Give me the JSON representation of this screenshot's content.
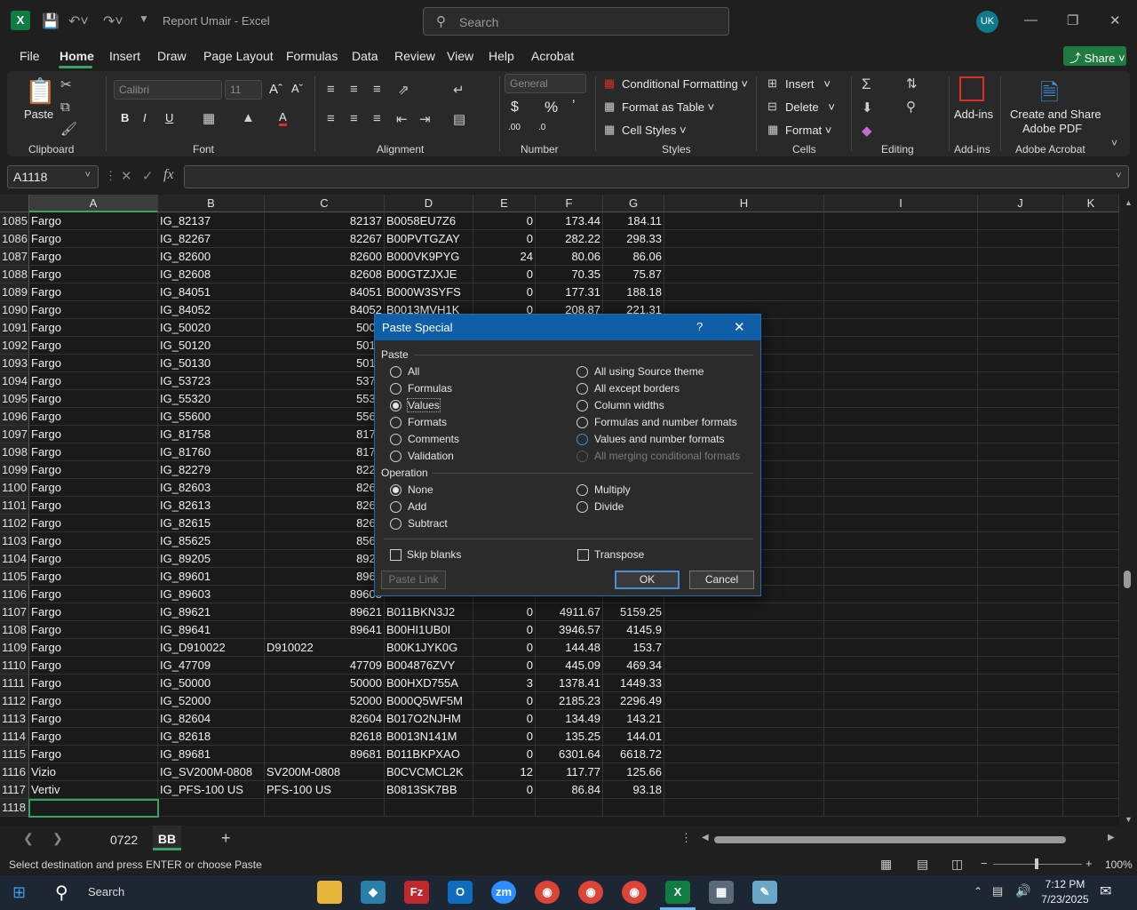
{
  "window": {
    "title": "Report Umair  -  Excel",
    "search_placeholder": "Search",
    "user_initials": "UK"
  },
  "menu": [
    "File",
    "Home",
    "Insert",
    "Draw",
    "Page Layout",
    "Formulas",
    "Data",
    "Review",
    "View",
    "Help",
    "Acrobat"
  ],
  "share_label": "Share",
  "ribbon": {
    "paste": "Paste",
    "font_name": "Calibri",
    "font_size": "11",
    "number_format": "General",
    "conditional_formatting": "Conditional Formatting",
    "format_as_table": "Format as Table",
    "cell_styles": "Cell Styles",
    "insert": "Insert",
    "delete": "Delete",
    "format": "Format",
    "addins": "Add-ins",
    "create_share_1": "Create and Share",
    "create_share_2": "Adobe PDF",
    "groups": [
      "Clipboard",
      "Font",
      "Alignment",
      "Number",
      "Styles",
      "Cells",
      "Editing",
      "Add-ins",
      "Adobe Acrobat"
    ]
  },
  "name_box": "A1118",
  "columns": [
    "A",
    "B",
    "C",
    "D",
    "E",
    "F",
    "G",
    "H",
    "I",
    "J",
    "K"
  ],
  "rows": [
    {
      "n": "1085",
      "a": "Fargo",
      "b": "IG_82137",
      "c": "82137",
      "d": "B0058EU7Z6",
      "e": "0",
      "f": "173.44",
      "g": "184.11"
    },
    {
      "n": "1086",
      "a": "Fargo",
      "b": "IG_82267",
      "c": "82267",
      "d": "B00PVTGZAY",
      "e": "0",
      "f": "282.22",
      "g": "298.33"
    },
    {
      "n": "1087",
      "a": "Fargo",
      "b": "IG_82600",
      "c": "82600",
      "d": "B000VK9PYG",
      "e": "24",
      "f": "80.06",
      "g": "86.06"
    },
    {
      "n": "1088",
      "a": "Fargo",
      "b": "IG_82608",
      "c": "82608",
      "d": "B00GTZJXJE",
      "e": "0",
      "f": "70.35",
      "g": "75.87"
    },
    {
      "n": "1089",
      "a": "Fargo",
      "b": "IG_84051",
      "c": "84051",
      "d": "B000W3SYFS",
      "e": "0",
      "f": "177.31",
      "g": "188.18"
    },
    {
      "n": "1090",
      "a": "Fargo",
      "b": "IG_84052",
      "c": "84052",
      "d": "B0013MVH1K",
      "e": "0",
      "f": "208.87",
      "g": "221.31"
    },
    {
      "n": "1091",
      "a": "Fargo",
      "b": "IG_50020",
      "c": "5002",
      "d": "",
      "e": "",
      "f": "",
      "g": ""
    },
    {
      "n": "1092",
      "a": "Fargo",
      "b": "IG_50120",
      "c": "5012",
      "d": "",
      "e": "",
      "f": "",
      "g": ""
    },
    {
      "n": "1093",
      "a": "Fargo",
      "b": "IG_50130",
      "c": "5013",
      "d": "",
      "e": "",
      "f": "",
      "g": ""
    },
    {
      "n": "1094",
      "a": "Fargo",
      "b": "IG_53723",
      "c": "5372",
      "d": "",
      "e": "",
      "f": "",
      "g": ""
    },
    {
      "n": "1095",
      "a": "Fargo",
      "b": "IG_55320",
      "c": "5532",
      "d": "",
      "e": "",
      "f": "",
      "g": ""
    },
    {
      "n": "1096",
      "a": "Fargo",
      "b": "IG_55600",
      "c": "5560",
      "d": "",
      "e": "",
      "f": "",
      "g": ""
    },
    {
      "n": "1097",
      "a": "Fargo",
      "b": "IG_81758",
      "c": "8175",
      "d": "",
      "e": "",
      "f": "",
      "g": ""
    },
    {
      "n": "1098",
      "a": "Fargo",
      "b": "IG_81760",
      "c": "8176",
      "d": "",
      "e": "",
      "f": "",
      "g": ""
    },
    {
      "n": "1099",
      "a": "Fargo",
      "b": "IG_82279",
      "c": "8227",
      "d": "",
      "e": "",
      "f": "",
      "g": ""
    },
    {
      "n": "1100",
      "a": "Fargo",
      "b": "IG_82603",
      "c": "8260",
      "d": "",
      "e": "",
      "f": "",
      "g": ""
    },
    {
      "n": "1101",
      "a": "Fargo",
      "b": "IG_82613",
      "c": "8261",
      "d": "",
      "e": "",
      "f": "",
      "g": ""
    },
    {
      "n": "1102",
      "a": "Fargo",
      "b": "IG_82615",
      "c": "8261",
      "d": "",
      "e": "",
      "f": "",
      "g": ""
    },
    {
      "n": "1103",
      "a": "Fargo",
      "b": "IG_85625",
      "c": "8562",
      "d": "",
      "e": "",
      "f": "",
      "g": ""
    },
    {
      "n": "1104",
      "a": "Fargo",
      "b": "IG_89205",
      "c": "8920",
      "d": "",
      "e": "",
      "f": "",
      "g": ""
    },
    {
      "n": "1105",
      "a": "Fargo",
      "b": "IG_89601",
      "c": "8960",
      "d": "",
      "e": "",
      "f": "",
      "g": ""
    },
    {
      "n": "1106",
      "a": "Fargo",
      "b": "IG_89603",
      "c": "89603",
      "d": "",
      "e": "",
      "f": "",
      "g": ""
    },
    {
      "n": "1107",
      "a": "Fargo",
      "b": "IG_89621",
      "c": "89621",
      "d": "B011BKN3J2",
      "e": "0",
      "f": "4911.67",
      "g": "5159.25"
    },
    {
      "n": "1108",
      "a": "Fargo",
      "b": "IG_89641",
      "c": "89641",
      "d": "B00HI1UB0I",
      "e": "0",
      "f": "3946.57",
      "g": "4145.9"
    },
    {
      "n": "1109",
      "a": "Fargo",
      "b": "IG_D910022",
      "c": "D910022",
      "d": "B00K1JYK0G",
      "e": "0",
      "f": "144.48",
      "g": "153.7"
    },
    {
      "n": "1110",
      "a": "Fargo",
      "b": "IG_47709",
      "c": "47709",
      "d": "B004876ZVY",
      "e": "0",
      "f": "445.09",
      "g": "469.34"
    },
    {
      "n": "1111",
      "a": "Fargo",
      "b": "IG_50000",
      "c": "50000",
      "d": "B00HXD755A",
      "e": "3",
      "f": "1378.41",
      "g": "1449.33"
    },
    {
      "n": "1112",
      "a": "Fargo",
      "b": "IG_52000",
      "c": "52000",
      "d": "B000Q5WF5M",
      "e": "0",
      "f": "2185.23",
      "g": "2296.49"
    },
    {
      "n": "1113",
      "a": "Fargo",
      "b": "IG_82604",
      "c": "82604",
      "d": "B017O2NJHM",
      "e": "0",
      "f": "134.49",
      "g": "143.21"
    },
    {
      "n": "1114",
      "a": "Fargo",
      "b": "IG_82618",
      "c": "82618",
      "d": "B0013N141M",
      "e": "0",
      "f": "135.25",
      "g": "144.01"
    },
    {
      "n": "1115",
      "a": "Fargo",
      "b": "IG_89681",
      "c": "89681",
      "d": "B011BKPXAO",
      "e": "0",
      "f": "6301.64",
      "g": "6618.72"
    },
    {
      "n": "1116",
      "a": "Vizio",
      "b": "IG_SV200M-0808",
      "c": "SV200M-0808",
      "d": "B0CVCMCL2K",
      "e": "12",
      "f": "117.77",
      "g": "125.66"
    },
    {
      "n": "1117",
      "a": "Vertiv",
      "b": "IG_PFS-100 US",
      "c": "PFS-100 US",
      "d": "B0813SK7BB",
      "e": "0",
      "f": "86.84",
      "g": "93.18"
    },
    {
      "n": "1118",
      "a": "",
      "b": "",
      "c": "",
      "d": "",
      "e": "",
      "f": "",
      "g": ""
    }
  ],
  "sheets": [
    "0722",
    "BB"
  ],
  "status": {
    "message": "Select destination and press ENTER or choose Paste",
    "zoom": "100%"
  },
  "taskbar": {
    "search": "Search",
    "time": "7:12 PM",
    "date": "7/23/2025"
  },
  "dialog": {
    "title": "Paste Special",
    "help": "?",
    "paste_label": "Paste",
    "paste_left": [
      {
        "label": "All",
        "selected": false
      },
      {
        "label": "Formulas",
        "selected": false
      },
      {
        "label": "Values",
        "selected": true
      },
      {
        "label": "Formats",
        "selected": false
      },
      {
        "label": "Comments",
        "selected": false
      },
      {
        "label": "Validation",
        "selected": false
      }
    ],
    "paste_right": [
      {
        "label": "All using Source theme",
        "selected": false
      },
      {
        "label": "All except borders",
        "selected": false
      },
      {
        "label": "Column widths",
        "selected": false
      },
      {
        "label": "Formulas and number formats",
        "selected": false
      },
      {
        "label": "Values and number formats",
        "selected": false
      },
      {
        "label": "All merging conditional formats",
        "selected": false,
        "disabled": true
      }
    ],
    "operation_label": "Operation",
    "op_left": [
      {
        "label": "None",
        "selected": true
      },
      {
        "label": "Add",
        "selected": false
      },
      {
        "label": "Subtract",
        "selected": false
      }
    ],
    "op_right": [
      {
        "label": "Multiply",
        "selected": false
      },
      {
        "label": "Divide",
        "selected": false
      }
    ],
    "skip_blanks": "Skip blanks",
    "transpose": "Transpose",
    "paste_link": "Paste Link",
    "ok": "OK",
    "cancel": "Cancel"
  }
}
